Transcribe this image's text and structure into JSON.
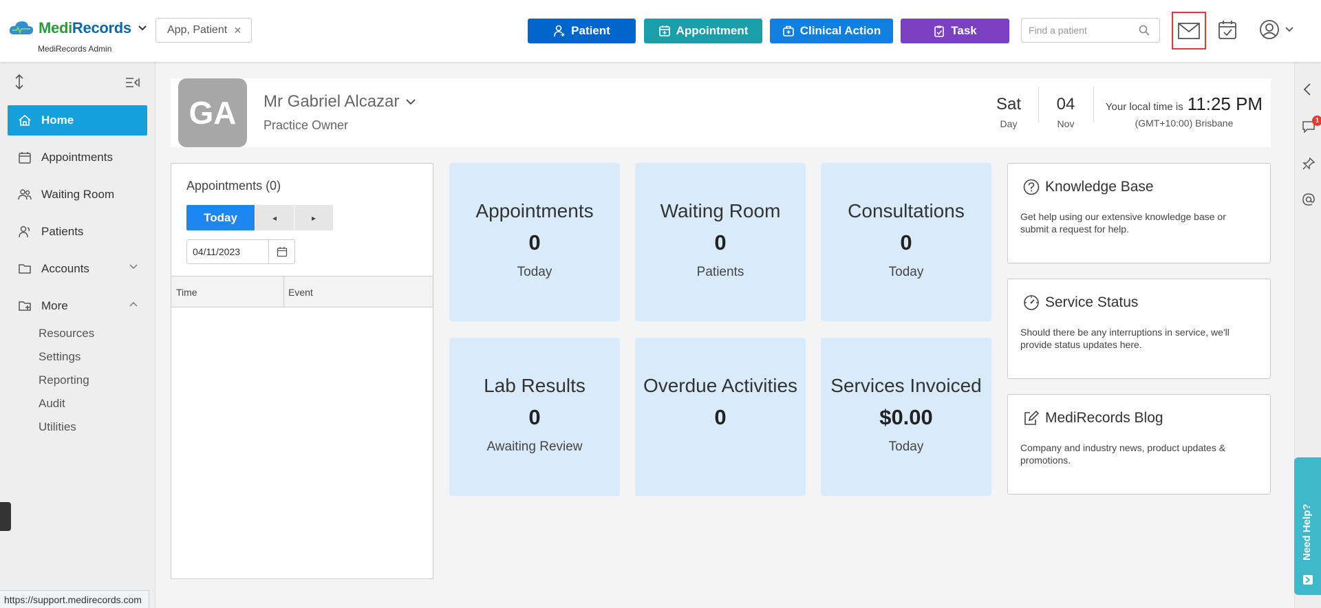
{
  "header": {
    "logo_medi": "Medi",
    "logo_records": "Records",
    "logo_sub": "MediRecords Admin",
    "chip_label": "App, Patient",
    "chip_close": "×",
    "buttons": [
      {
        "label": "Patient",
        "color": "#0066cc"
      },
      {
        "label": "Appointment",
        "color": "#1a9eaa"
      },
      {
        "label": "Clinical Action",
        "color": "#0f7fe0"
      },
      {
        "label": "Task",
        "color": "#7b3fc2"
      }
    ],
    "search_placeholder": "Find a patient"
  },
  "sidebar": {
    "items": [
      {
        "label": "Home"
      },
      {
        "label": "Appointments"
      },
      {
        "label": "Waiting Room"
      },
      {
        "label": "Patients"
      },
      {
        "label": "Accounts"
      },
      {
        "label": "More"
      }
    ],
    "sub_items": [
      "Resources",
      "Settings",
      "Reporting",
      "Audit",
      "Utilities"
    ]
  },
  "status_url": "https://support.medirecords.com",
  "profile": {
    "initials": "GA",
    "name": "Mr Gabriel Alcazar",
    "role": "Practice Owner",
    "day": "Sat",
    "day_label": "Day",
    "date": "04",
    "month": "Nov",
    "local_time_label": "Your local time is",
    "local_time": "11:25 PM",
    "timezone": "(GMT+10:00) Brisbane"
  },
  "appointments_panel": {
    "title": "Appointments (0)",
    "today_label": "Today",
    "prev_label": "◂",
    "next_label": "▸",
    "date_value": "04/11/2023",
    "col_time": "Time",
    "col_event": "Event"
  },
  "cards": [
    {
      "title": "Appointments",
      "value": "0",
      "sub": "Today"
    },
    {
      "title": "Waiting Room",
      "value": "0",
      "sub": "Patients"
    },
    {
      "title": "Consultations",
      "value": "0",
      "sub": "Today"
    },
    {
      "title": "Lab Results",
      "value": "0",
      "sub": "Awaiting Review"
    },
    {
      "title": "Overdue Activities",
      "value": "0",
      "sub": ""
    },
    {
      "title": "Services Invoiced",
      "value": "$0.00",
      "sub": "Today"
    }
  ],
  "info_panels": [
    {
      "title": "Knowledge Base",
      "desc": "Get help using our extensive knowledge base or submit a request for help."
    },
    {
      "title": "Service Status",
      "desc": "Should there be any interruptions in service, we'll provide status updates here."
    },
    {
      "title": "MediRecords Blog",
      "desc": "Company and industry news, product updates & promotions."
    }
  ],
  "rail": {
    "badge_count": "1",
    "need_help": "Need Help?"
  }
}
